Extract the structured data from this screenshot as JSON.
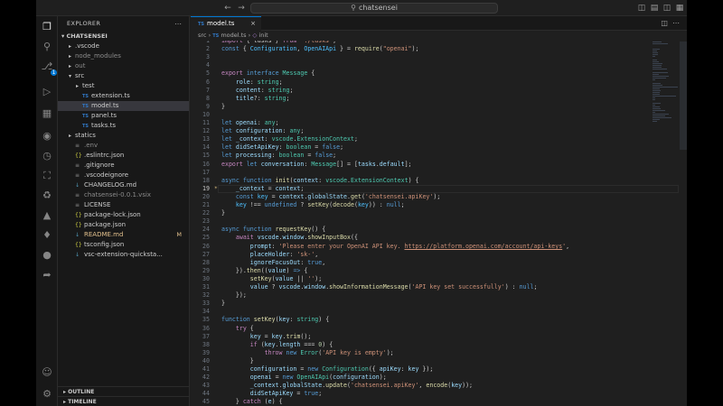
{
  "window": {
    "search_text": "chatsensei"
  },
  "sidebar": {
    "title": "EXPLORER",
    "root": "CHATSENSEI",
    "items": [
      {
        "label": ".vscode",
        "type": "folder",
        "depth": 1,
        "collapsed": true
      },
      {
        "label": "node_modules",
        "type": "folder",
        "depth": 1,
        "collapsed": true,
        "dim": true
      },
      {
        "label": "out",
        "type": "folder",
        "depth": 1,
        "collapsed": true,
        "dim": true
      },
      {
        "label": "src",
        "type": "folder",
        "depth": 1,
        "collapsed": false
      },
      {
        "label": "test",
        "type": "folder",
        "depth": 2,
        "collapsed": true
      },
      {
        "label": "extension.ts",
        "type": "ts",
        "depth": 2
      },
      {
        "label": "model.ts",
        "type": "ts",
        "depth": 2,
        "selected": true
      },
      {
        "label": "panel.ts",
        "type": "ts",
        "depth": 2
      },
      {
        "label": "tasks.ts",
        "type": "ts",
        "depth": 2
      },
      {
        "label": "statics",
        "type": "folder",
        "depth": 1,
        "collapsed": true
      },
      {
        "label": ".env",
        "type": "file",
        "depth": 1,
        "dim": true
      },
      {
        "label": ".eslintrc.json",
        "type": "json",
        "depth": 1
      },
      {
        "label": ".gitignore",
        "type": "file",
        "depth": 1
      },
      {
        "label": ".vscodeignore",
        "type": "file",
        "depth": 1
      },
      {
        "label": "CHANGELOG.md",
        "type": "md",
        "depth": 1
      },
      {
        "label": "chatsensei-0.0.1.vsix",
        "type": "file",
        "depth": 1,
        "dim": true
      },
      {
        "label": "LICENSE",
        "type": "file",
        "depth": 1
      },
      {
        "label": "package-lock.json",
        "type": "json",
        "depth": 1
      },
      {
        "label": "package.json",
        "type": "json",
        "depth": 1
      },
      {
        "label": "README.md",
        "type": "md",
        "depth": 1,
        "modified": true,
        "mark": "M"
      },
      {
        "label": "tsconfig.json",
        "type": "json",
        "depth": 1
      },
      {
        "label": "vsc-extension-quicksta...",
        "type": "md",
        "depth": 1
      }
    ],
    "outline": "OUTLINE",
    "timeline": "TIMELINE"
  },
  "activity": {
    "scm_badge": "1"
  },
  "editor": {
    "tab_label": "model.ts",
    "breadcrumb": [
      "src",
      "model.ts",
      "init"
    ],
    "lines": [
      {
        "n": "1",
        "html": "<span class='kc'>import</span> { tasks } <span class='kc'>from</span> <span class='s'>'./tasks'</span>;"
      },
      {
        "n": "2",
        "html": "<span class='k'>const</span> { <span class='c'>Configuration</span>, <span class='c'>OpenAIApi</span> } = <span class='f'>require</span>(<span class='s'>\"openai\"</span>);"
      },
      {
        "n": "3",
        "html": ""
      },
      {
        "n": "4",
        "html": ""
      },
      {
        "n": "5",
        "html": "<span class='kc'>export</span> <span class='k'>interface</span> <span class='t'>Message</span> {"
      },
      {
        "n": "6",
        "html": "    <span class='v'>role</span>: <span class='t'>string</span>;"
      },
      {
        "n": "7",
        "html": "    <span class='v'>content</span>: <span class='t'>string</span>;"
      },
      {
        "n": "8",
        "html": "    <span class='v'>title</span>?: <span class='t'>string</span>;"
      },
      {
        "n": "9",
        "html": "}"
      },
      {
        "n": "10",
        "html": ""
      },
      {
        "n": "11",
        "html": "<span class='k'>let</span> <span class='v'>openai</span>: <span class='t'>any</span>;"
      },
      {
        "n": "12",
        "html": "<span class='k'>let</span> <span class='v'>configuration</span>: <span class='t'>any</span>;"
      },
      {
        "n": "13",
        "html": "<span class='k'>let</span> <span class='v'>_context</span>: <span class='t'>vscode</span>.<span class='t'>ExtensionContext</span>;"
      },
      {
        "n": "14",
        "html": "<span class='k'>let</span> <span class='v'>didSetApiKey</span>: <span class='t'>boolean</span> = <span class='k'>false</span>;"
      },
      {
        "n": "15",
        "html": "<span class='k'>let</span> <span class='v'>processing</span>: <span class='t'>boolean</span> = <span class='k'>false</span>;"
      },
      {
        "n": "16",
        "html": "<span class='kc'>export</span> <span class='k'>let</span> <span class='v'>conversation</span>: <span class='t'>Message</span>[] = [<span class='v'>tasks</span>.<span class='v'>default</span>];"
      },
      {
        "n": "17",
        "html": ""
      },
      {
        "n": "18",
        "html": "<span class='k'>async</span> <span class='k'>function</span> <span class='f'>init</span>(<span class='v'>context</span>: <span class='t'>vscode</span>.<span class='t'>ExtensionContext</span>) {"
      },
      {
        "n": "19",
        "html": "    <span class='v'>_context</span> = <span class='v'>context</span>;",
        "current": true
      },
      {
        "n": "20",
        "html": "    <span class='k'>const</span> <span class='c'>key</span> = <span class='v'>context</span>.<span class='v'>globalState</span>.<span class='f'>get</span>(<span class='s'>'chatsensei.apiKey'</span>);"
      },
      {
        "n": "21",
        "html": "    <span class='c'>key</span> !== <span class='k'>undefined</span> ? <span class='f'>setKey</span>(<span class='f'>decode</span>(<span class='c'>key</span>)) : <span class='k'>null</span>;"
      },
      {
        "n": "22",
        "html": "}"
      },
      {
        "n": "23",
        "html": ""
      },
      {
        "n": "24",
        "html": "<span class='k'>async</span> <span class='k'>function</span> <span class='f'>requestKey</span>() {"
      },
      {
        "n": "25",
        "html": "    <span class='kc'>await</span> <span class='v'>vscode</span>.<span class='v'>window</span>.<span class='f'>showInputBox</span>({"
      },
      {
        "n": "26",
        "html": "        <span class='v'>prompt</span>: <span class='s'>'Please enter your OpenAI API key. </span><span class='u'>https://platform.openai.com/account/api-keys</span><span class='s'>'</span>,"
      },
      {
        "n": "27",
        "html": "        <span class='v'>placeHolder</span>: <span class='s'>'sk-'</span>,"
      },
      {
        "n": "28",
        "html": "        <span class='v'>ignoreFocusOut</span>: <span class='k'>true</span>,"
      },
      {
        "n": "29",
        "html": "    }).<span class='f'>then</span>((<span class='v'>value</span>) <span class='k'>=&gt;</span> {"
      },
      {
        "n": "30",
        "html": "        <span class='f'>setKey</span>(<span class='v'>value</span> || <span class='s'>''</span>);"
      },
      {
        "n": "31",
        "html": "        <span class='v'>value</span> ? <span class='v'>vscode</span>.<span class='v'>window</span>.<span class='f'>showInformationMessage</span>(<span class='s'>'API key set successfully'</span>) : <span class='k'>null</span>;"
      },
      {
        "n": "32",
        "html": "    });"
      },
      {
        "n": "33",
        "html": "}"
      },
      {
        "n": "34",
        "html": ""
      },
      {
        "n": "35",
        "html": "<span class='k'>function</span> <span class='f'>setKey</span>(<span class='v'>key</span>: <span class='t'>string</span>) {"
      },
      {
        "n": "36",
        "html": "    <span class='kc'>try</span> {"
      },
      {
        "n": "37",
        "html": "        <span class='v'>key</span> = <span class='v'>key</span>.<span class='f'>trim</span>();"
      },
      {
        "n": "38",
        "html": "        <span class='kc'>if</span> (<span class='v'>key</span>.<span class='v'>length</span> === <span class='n'>0</span>) {"
      },
      {
        "n": "39",
        "html": "            <span class='kc'>throw</span> <span class='k'>new</span> <span class='t'>Error</span>(<span class='s'>'API key is empty'</span>);"
      },
      {
        "n": "40",
        "html": "        }"
      },
      {
        "n": "41",
        "html": "        <span class='v'>configuration</span> = <span class='k'>new</span> <span class='t'>Configuration</span>({ <span class='v'>apiKey</span>: <span class='v'>key</span> });"
      },
      {
        "n": "42",
        "html": "        <span class='v'>openai</span> = <span class='k'>new</span> <span class='t'>OpenAIApi</span>(<span class='v'>configuration</span>);"
      },
      {
        "n": "43",
        "html": "        <span class='v'>_context</span>.<span class='v'>globalState</span>.<span class='f'>update</span>(<span class='s'>'chatsensei.apiKey'</span>, <span class='f'>encode</span>(<span class='v'>key</span>));"
      },
      {
        "n": "44",
        "html": "        <span class='v'>didSetApiKey</span> = <span class='k'>true</span>;"
      },
      {
        "n": "45",
        "html": "    } <span class='kc'>catch</span> (<span class='v'>e</span>) {"
      }
    ]
  }
}
